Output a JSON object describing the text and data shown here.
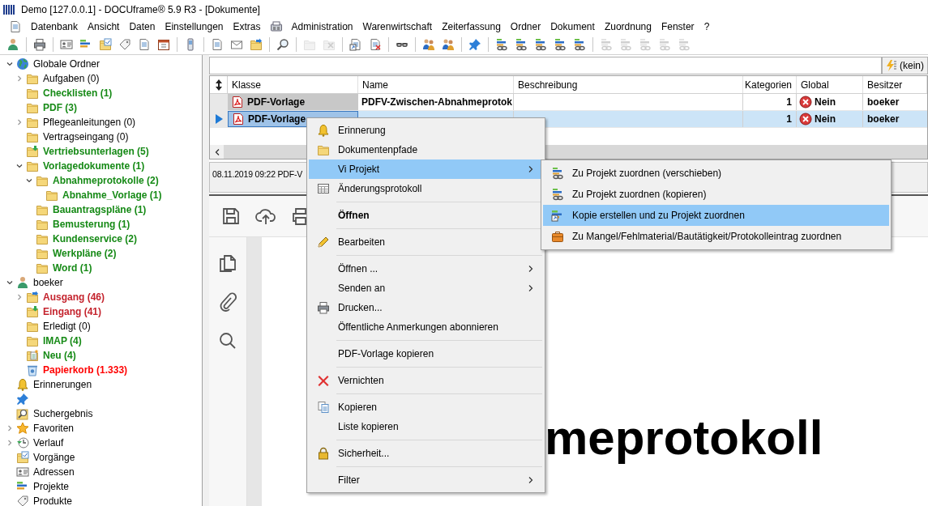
{
  "window": {
    "title": "Demo [127.0.0.1] - DOCUframe® 5.9 R3 - [Dokumente]"
  },
  "menus": [
    {
      "kind": "document"
    },
    {
      "kind": "text",
      "label": "Datenbank"
    },
    {
      "kind": "text",
      "label": "Ansicht"
    },
    {
      "kind": "text",
      "label": "Daten"
    },
    {
      "kind": "text",
      "label": "Einstellungen"
    },
    {
      "kind": "text",
      "label": "Extras"
    },
    {
      "kind": "fax"
    },
    {
      "kind": "text",
      "label": "Administration"
    },
    {
      "kind": "text",
      "label": "Warenwirtschaft"
    },
    {
      "kind": "text",
      "label": "Zeiterfassung"
    },
    {
      "kind": "text",
      "label": "Ordner"
    },
    {
      "kind": "text",
      "label": "Dokument"
    },
    {
      "kind": "text",
      "label": "Zuordnung"
    },
    {
      "kind": "text",
      "label": "Fenster"
    },
    {
      "kind": "text",
      "label": "?"
    }
  ],
  "toolbar": [
    [
      {
        "kind": "person",
        "disabled": false
      }
    ],
    [
      {
        "kind": "printer",
        "disabled": false
      }
    ],
    [
      {
        "kind": "card",
        "disabled": false
      },
      {
        "kind": "bars",
        "disabled": false
      },
      {
        "kind": "folder-check",
        "disabled": false
      },
      {
        "kind": "tag",
        "disabled": false
      },
      {
        "kind": "doc",
        "disabled": false
      },
      {
        "kind": "calendar",
        "disabled": false
      }
    ],
    [
      {
        "kind": "phone",
        "disabled": false
      }
    ],
    [
      {
        "kind": "doc",
        "disabled": false
      },
      {
        "kind": "mail",
        "disabled": false
      },
      {
        "kind": "folder-out",
        "disabled": false
      }
    ],
    [
      {
        "kind": "magnifier",
        "disabled": false
      }
    ],
    [
      {
        "kind": "folder",
        "disabled": true
      },
      {
        "kind": "folder-x",
        "disabled": true
      }
    ],
    [
      {
        "kind": "doc-link",
        "disabled": false
      },
      {
        "kind": "doc-delete",
        "disabled": false
      }
    ],
    [
      {
        "kind": "glasses",
        "disabled": false
      }
    ],
    [
      {
        "kind": "people",
        "disabled": false
      },
      {
        "kind": "people",
        "disabled": false
      }
    ],
    [
      {
        "kind": "pin",
        "disabled": false
      }
    ],
    [
      {
        "kind": "bars-link",
        "disabled": false
      },
      {
        "kind": "bars-link",
        "disabled": false
      },
      {
        "kind": "bars-link",
        "disabled": false
      },
      {
        "kind": "bars-link",
        "disabled": false
      },
      {
        "kind": "bars-link",
        "disabled": false
      }
    ],
    [
      {
        "kind": "bars-link",
        "disabled": true
      },
      {
        "kind": "bars-link",
        "disabled": true
      },
      {
        "kind": "bars-link",
        "disabled": true
      },
      {
        "kind": "bars-link",
        "disabled": true
      },
      {
        "kind": "bars-link",
        "disabled": true
      }
    ]
  ],
  "tree": [
    {
      "label": "Globale Ordner",
      "kind": "globe",
      "expanded": true,
      "color": "#000000",
      "bold": false,
      "children": [
        {
          "label": "Aufgaben (0)",
          "kind": "folder",
          "expanded": false,
          "color": "#000000",
          "bold": false
        },
        {
          "label": "Checklisten (1)",
          "kind": "folder",
          "color": "#168a16",
          "bold": true
        },
        {
          "label": "PDF (3)",
          "kind": "folder",
          "color": "#168a16",
          "bold": true
        },
        {
          "label": "Pflegeanleitungen (0)",
          "kind": "folder",
          "expanded": false,
          "color": "#000000",
          "bold": false
        },
        {
          "label": "Vertragseingang (0)",
          "kind": "folder",
          "color": "#000000",
          "bold": false
        },
        {
          "label": "Vertriebsunterlagen (5)",
          "kind": "folder-in",
          "color": "#168a16",
          "bold": true
        },
        {
          "label": "Vorlagedokumente (1)",
          "kind": "folder",
          "expanded": true,
          "color": "#168a16",
          "bold": true,
          "children": [
            {
              "label": "Abnahmeprotokolle (2)",
              "kind": "folder",
              "expanded": true,
              "color": "#168a16",
              "bold": true,
              "children": [
                {
                  "label": "Abnahme_Vorlage (1)",
                  "kind": "folder",
                  "color": "#168a16",
                  "bold": true
                }
              ]
            },
            {
              "label": "Bauantragspläne (1)",
              "kind": "folder",
              "color": "#168a16",
              "bold": true
            },
            {
              "label": "Bemusterung (1)",
              "kind": "folder",
              "color": "#168a16",
              "bold": true
            },
            {
              "label": "Kundenservice (2)",
              "kind": "folder",
              "color": "#168a16",
              "bold": true
            },
            {
              "label": "Werkpläne (2)",
              "kind": "folder",
              "color": "#168a16",
              "bold": true
            },
            {
              "label": "Word (1)",
              "kind": "folder",
              "color": "#168a16",
              "bold": true
            }
          ]
        }
      ]
    },
    {
      "label": "boeker",
      "kind": "person",
      "expanded": true,
      "color": "#000000",
      "bold": false,
      "children": [
        {
          "label": "Ausgang (46)",
          "kind": "folder-out",
          "expanded": false,
          "color": "#c4232d",
          "bold": true
        },
        {
          "label": "Eingang (41)",
          "kind": "folder-in",
          "color": "#c4232d",
          "bold": true
        },
        {
          "label": "Erledigt (0)",
          "kind": "folder",
          "color": "#000000",
          "bold": false
        },
        {
          "label": "IMAP (4)",
          "kind": "folder",
          "color": "#168a16",
          "bold": true
        },
        {
          "label": "Neu (4)",
          "kind": "folder-new",
          "color": "#168a16",
          "bold": true
        },
        {
          "label": "Papierkorb (1.333)",
          "kind": "trash",
          "color": "#ff0000",
          "bold": true
        }
      ]
    },
    {
      "label": "Erinnerungen",
      "kind": "bell",
      "color": "#000000",
      "bold": false
    },
    {
      "kind": "pin"
    },
    {
      "label": "Suchergebnis",
      "kind": "search",
      "color": "#000000",
      "bold": false
    },
    {
      "label": "Favoriten",
      "kind": "star",
      "expanded": false,
      "color": "#000000",
      "bold": false
    },
    {
      "label": "Verlauf",
      "kind": "clock",
      "expanded": false,
      "color": "#000000",
      "bold": false
    },
    {
      "label": "Vorgänge",
      "kind": "folder-check",
      "color": "#000000",
      "bold": false
    },
    {
      "label": "Adressen",
      "kind": "card",
      "color": "#000000",
      "bold": false
    },
    {
      "label": "Projekte",
      "kind": "bars",
      "color": "#000000",
      "bold": false
    },
    {
      "label": "Produkte",
      "kind": "tag",
      "color": "#000000",
      "bold": false
    }
  ],
  "filter": {
    "label": "(kein)"
  },
  "table": {
    "columns": [
      "Klasse",
      "Name",
      "Beschreibung",
      "Kategorien",
      "Global",
      "Besitzer"
    ],
    "rows": [
      {
        "selected": false,
        "klasse": "PDF-Vorlage",
        "name": "PDFV-Zwischen-Abnahmeprotok",
        "kategorien": "1",
        "global": "Nein",
        "besitzer": "boeker"
      },
      {
        "selected": true,
        "klasse": "PDF-Vorlage",
        "kategorien": "1",
        "global": "Nein",
        "besitzer": "boeker"
      }
    ]
  },
  "status_text": "08.11.2019 09:22 PDF-V",
  "document_text": "meprotokoll",
  "context_menu": [
    {
      "kind": "bell",
      "label": "Erinnerung",
      "bold": false,
      "submenu": false,
      "selected": false
    },
    {
      "kind": "folder",
      "label": "Dokumentenpfade",
      "bold": false,
      "submenu": false,
      "selected": false
    },
    {
      "kind": "plain",
      "label": "Vi Projekt",
      "bold": false,
      "submenu": true,
      "selected": true
    },
    {
      "kind": "table",
      "label": "Änderungsprotokoll",
      "bold": false,
      "submenu": false,
      "selected": false
    },
    {
      "kind": "separator"
    },
    {
      "kind": "plain",
      "label": "Öffnen",
      "bold": true,
      "submenu": false,
      "selected": false
    },
    {
      "kind": "separator"
    },
    {
      "kind": "pencil",
      "label": "Bearbeiten",
      "bold": false,
      "submenu": false,
      "selected": false
    },
    {
      "kind": "separator"
    },
    {
      "kind": "plain",
      "label": "Öffnen ...",
      "bold": false,
      "submenu": true,
      "selected": false
    },
    {
      "kind": "plain",
      "label": "Senden an",
      "bold": false,
      "submenu": true,
      "selected": false
    },
    {
      "kind": "printer",
      "label": "Drucken...",
      "bold": false,
      "submenu": false,
      "selected": false
    },
    {
      "kind": "plain",
      "label": "Öffentliche Anmerkungen abonnieren",
      "bold": false,
      "submenu": false,
      "selected": false
    },
    {
      "kind": "separator"
    },
    {
      "kind": "plain",
      "label": "PDF-Vorlage kopieren",
      "bold": false,
      "submenu": false,
      "selected": false
    },
    {
      "kind": "separator"
    },
    {
      "kind": "cross",
      "label": "Vernichten",
      "bold": false,
      "submenu": false,
      "selected": false
    },
    {
      "kind": "separator"
    },
    {
      "kind": "copy",
      "label": "Kopieren",
      "bold": false,
      "submenu": false,
      "selected": false
    },
    {
      "kind": "plain",
      "label": "Liste kopieren",
      "bold": false,
      "submenu": false,
      "selected": false
    },
    {
      "kind": "separator"
    },
    {
      "kind": "lock",
      "label": "Sicherheit...",
      "bold": false,
      "submenu": false,
      "selected": false
    },
    {
      "kind": "separator"
    },
    {
      "kind": "plain",
      "label": "Filter",
      "bold": false,
      "submenu": true,
      "selected": false
    }
  ],
  "submenu": [
    {
      "kind": "bars-link",
      "label": "Zu Projekt zuordnen (verschieben)",
      "selected": false
    },
    {
      "kind": "bars-link",
      "label": "Zu Projekt zuordnen (kopieren)",
      "selected": false
    },
    {
      "kind": "bars-shortcut",
      "label": "Kopie erstellen und zu Projekt zuordnen",
      "selected": true
    },
    {
      "kind": "briefcase",
      "label": "Zu Mangel/Fehlmaterial/Bautätigkeit/Protokolleintrag zuordnen",
      "selected": false
    }
  ]
}
